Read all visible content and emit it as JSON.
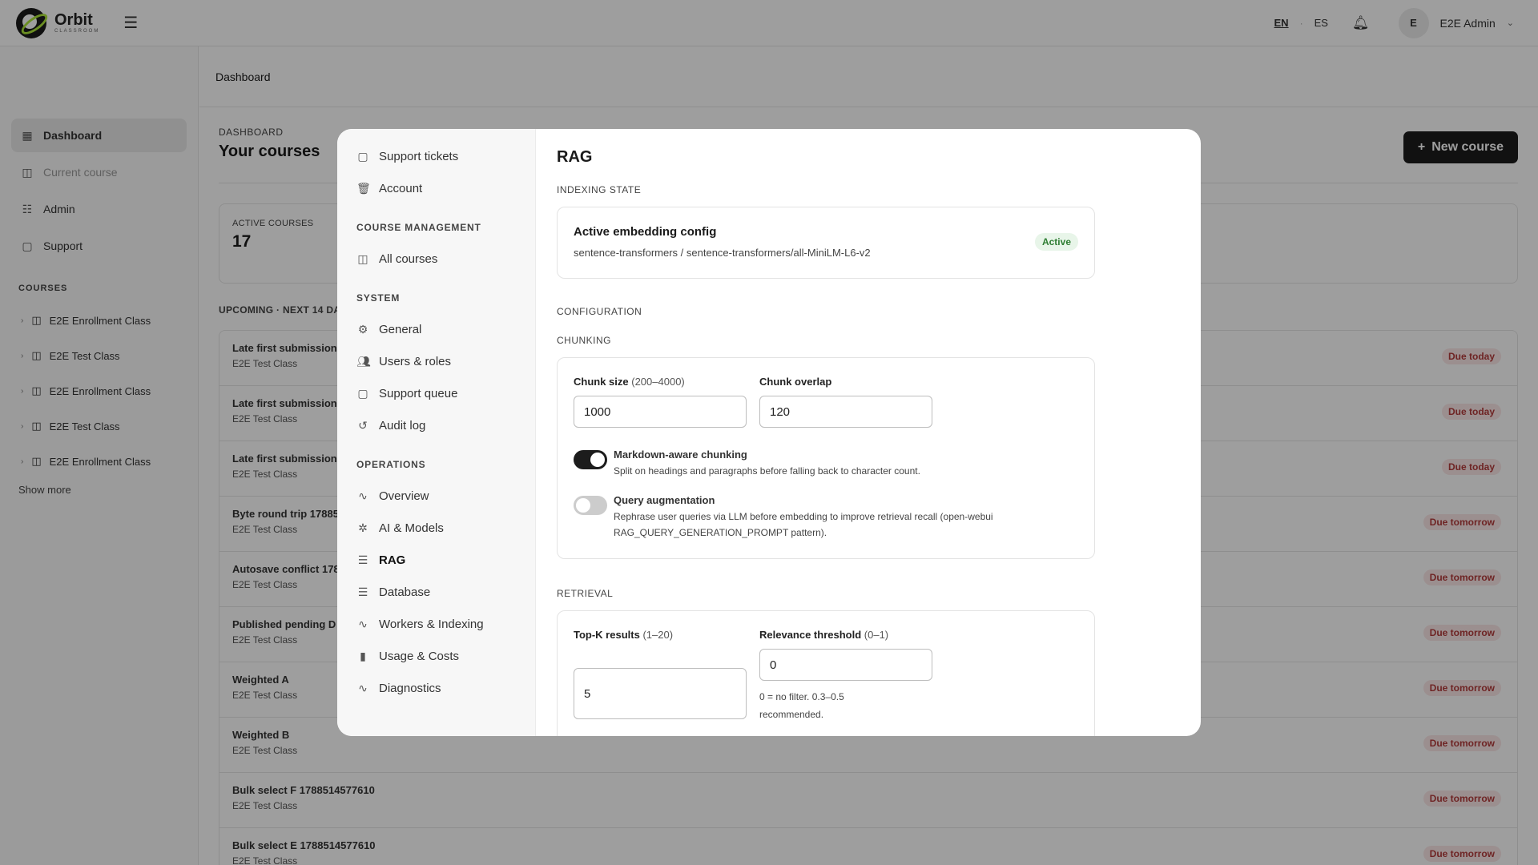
{
  "topbar": {
    "brand": "Orbit",
    "brand_sub": "CLASSROOM",
    "lang_en": "EN",
    "lang_sep": "·",
    "lang_es": "ES",
    "avatar_initial": "E",
    "user_name": "E2E Admin"
  },
  "sidebar": {
    "nav": [
      {
        "label": "Dashboard",
        "icon": "grid-icon"
      },
      {
        "label": "Current course",
        "icon": "book-icon"
      },
      {
        "label": "Admin",
        "icon": "sliders-icon"
      },
      {
        "label": "Support",
        "icon": "chat-icon"
      }
    ],
    "courses_heading": "COURSES",
    "courses": [
      "E2E Enrollment Class",
      "E2E Test Class",
      "E2E Enrollment Class",
      "E2E Test Class",
      "E2E Enrollment Class"
    ],
    "show_more": "Show more"
  },
  "main": {
    "breadcrumb": "Dashboard",
    "eyebrow": "DASHBOARD",
    "title": "Your courses",
    "new_course": "New course",
    "stat_label": "ACTIVE COURSES",
    "stat_value": "17",
    "upcoming": "UPCOMING · NEXT 14 DA",
    "rows": [
      {
        "title": "Late first submission",
        "sub": "E2E Test Class",
        "due": "Due today"
      },
      {
        "title": "Late first submission",
        "sub": "E2E Test Class",
        "due": "Due today"
      },
      {
        "title": "Late first submission",
        "sub": "E2E Test Class",
        "due": "Due today"
      },
      {
        "title": "Byte round trip 17885",
        "sub": "E2E Test Class",
        "due": "Due tomorrow"
      },
      {
        "title": "Autosave conflict 178",
        "sub": "E2E Test Class",
        "due": "Due tomorrow"
      },
      {
        "title": "Published pending D",
        "sub": "E2E Test Class",
        "due": "Due tomorrow"
      },
      {
        "title": "Weighted A",
        "sub": "E2E Test Class",
        "due": "Due tomorrow"
      },
      {
        "title": "Weighted B",
        "sub": "E2E Test Class",
        "due": "Due tomorrow"
      },
      {
        "title": "Bulk select F 1788514577610",
        "sub": "E2E Test Class",
        "due": "Due tomorrow"
      },
      {
        "title": "Bulk select E 1788514577610",
        "sub": "E2E Test Class",
        "due": "Due tomorrow"
      }
    ]
  },
  "modal": {
    "nav_top": [
      {
        "label": "Support tickets",
        "icon": "chat-icon"
      },
      {
        "label": "Account",
        "icon": "trash-icon"
      }
    ],
    "course_mgmt_heading": "COURSE MANAGEMENT",
    "course_mgmt": [
      {
        "label": "All courses",
        "icon": "book-icon"
      }
    ],
    "system_heading": "SYSTEM",
    "system": [
      {
        "label": "General",
        "icon": "gear-icon"
      },
      {
        "label": "Users & roles",
        "icon": "users-icon"
      },
      {
        "label": "Support queue",
        "icon": "chat-icon"
      },
      {
        "label": "Audit log",
        "icon": "history-icon"
      }
    ],
    "operations_heading": "OPERATIONS",
    "operations": [
      {
        "label": "Overview",
        "icon": "pulse-icon"
      },
      {
        "label": "AI & Models",
        "icon": "cog-icon"
      },
      {
        "label": "RAG",
        "icon": "database-icon"
      },
      {
        "label": "Database",
        "icon": "database-icon"
      },
      {
        "label": "Workers & Indexing",
        "icon": "pulse-icon"
      },
      {
        "label": "Usage & Costs",
        "icon": "bar-chart-icon"
      },
      {
        "label": "Diagnostics",
        "icon": "pulse-icon"
      }
    ],
    "title": "RAG",
    "indexing_state": "INDEXING STATE",
    "embed_title": "Active embedding config",
    "embed_sub": "sentence-transformers / sentence-transformers/all-MiniLM-L6-v2",
    "embed_badge": "Active",
    "configuration": "CONFIGURATION",
    "chunking": "CHUNKING",
    "chunk_size_label": "Chunk size",
    "chunk_size_hint": "(200–4000)",
    "chunk_size_value": "1000",
    "chunk_overlap_label": "Chunk overlap",
    "chunk_overlap_value": "120",
    "md_title": "Markdown-aware chunking",
    "md_desc": "Split on headings and paragraphs before falling back to character count.",
    "md_on": true,
    "qa_title": "Query augmentation",
    "qa_desc": "Rephrase user queries via LLM before embedding to improve retrieval recall (open-webui RAG_QUERY_GENERATION_PROMPT pattern).",
    "qa_on": false,
    "retrieval": "RETRIEVAL",
    "topk_label": "Top-K results",
    "topk_hint": "(1–20)",
    "topk_value": "5",
    "rel_label": "Relevance threshold",
    "rel_hint": "(0–1)",
    "rel_value": "0",
    "rel_note": "0 = no filter. 0.3–0.5 recommended."
  }
}
